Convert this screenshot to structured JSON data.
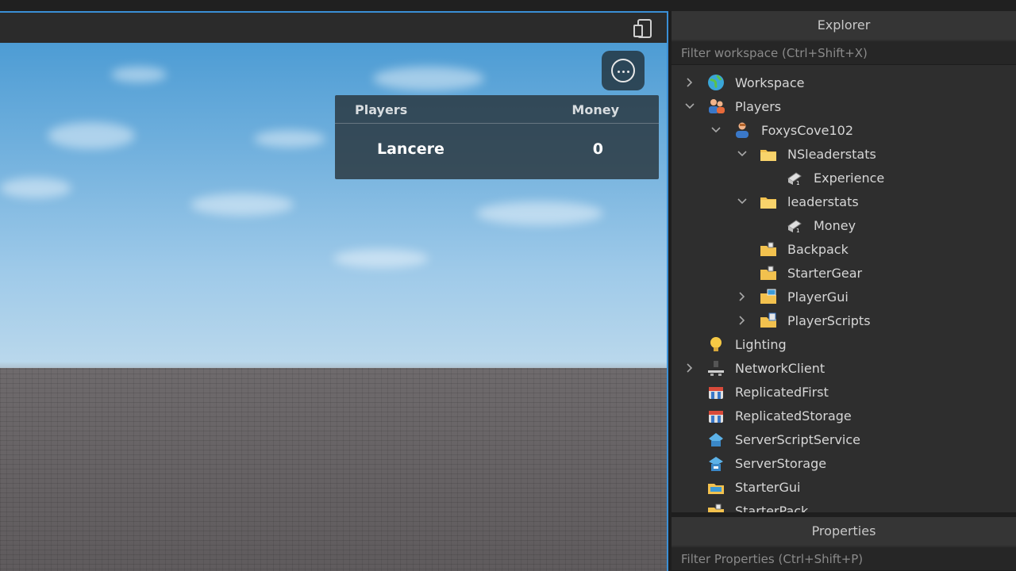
{
  "viewport": {
    "leaderboard": {
      "header_players": "Players",
      "header_money": "Money",
      "rows": [
        {
          "name": "Lancere",
          "money": "0"
        }
      ]
    },
    "menu_icon": "more-options-icon",
    "device_icon": "device-emulator-icon"
  },
  "explorer": {
    "title": "Explorer",
    "filter_placeholder": "Filter workspace (Ctrl+Shift+X)",
    "items": [
      {
        "label": "Workspace",
        "icon": "workspace-globe-icon",
        "depth": 0,
        "expander": "collapsed"
      },
      {
        "label": "Players",
        "icon": "players-icon",
        "depth": 0,
        "expander": "expanded"
      },
      {
        "label": "FoxysCove102",
        "icon": "player-icon",
        "depth": 1,
        "expander": "expanded"
      },
      {
        "label": "NSleaderstats",
        "icon": "folder-icon",
        "depth": 2,
        "expander": "expanded"
      },
      {
        "label": "Experience",
        "icon": "int-value-icon",
        "depth": 3,
        "expander": "none"
      },
      {
        "label": "leaderstats",
        "icon": "folder-icon",
        "depth": 2,
        "expander": "expanded"
      },
      {
        "label": "Money",
        "icon": "int-value-icon",
        "depth": 3,
        "expander": "none"
      },
      {
        "label": "Backpack",
        "icon": "backpack-icon",
        "depth": 2,
        "expander": "none"
      },
      {
        "label": "StarterGear",
        "icon": "starter-gear-icon",
        "depth": 2,
        "expander": "none"
      },
      {
        "label": "PlayerGui",
        "icon": "player-gui-icon",
        "depth": 2,
        "expander": "collapsed"
      },
      {
        "label": "PlayerScripts",
        "icon": "player-scripts-icon",
        "depth": 2,
        "expander": "collapsed"
      },
      {
        "label": "Lighting",
        "icon": "lighting-bulb-icon",
        "depth": 0,
        "expander": "none"
      },
      {
        "label": "NetworkClient",
        "icon": "network-client-icon",
        "depth": 0,
        "expander": "collapsed"
      },
      {
        "label": "ReplicatedFirst",
        "icon": "replicated-first-icon",
        "depth": 0,
        "expander": "none"
      },
      {
        "label": "ReplicatedStorage",
        "icon": "replicated-storage-icon",
        "depth": 0,
        "expander": "none"
      },
      {
        "label": "ServerScriptService",
        "icon": "server-script-service-icon",
        "depth": 0,
        "expander": "none"
      },
      {
        "label": "ServerStorage",
        "icon": "server-storage-icon",
        "depth": 0,
        "expander": "none"
      },
      {
        "label": "StarterGui",
        "icon": "starter-gui-icon",
        "depth": 0,
        "expander": "none"
      },
      {
        "label": "StarterPack",
        "icon": "starter-pack-icon",
        "depth": 0,
        "expander": "none"
      }
    ]
  },
  "properties": {
    "title": "Properties",
    "filter_placeholder": "Filter Properties (Ctrl+Shift+P)"
  },
  "colors": {
    "accent": "#3a8fd6",
    "panel_bg": "#2e2e2e",
    "folder": "#f2c14e"
  }
}
